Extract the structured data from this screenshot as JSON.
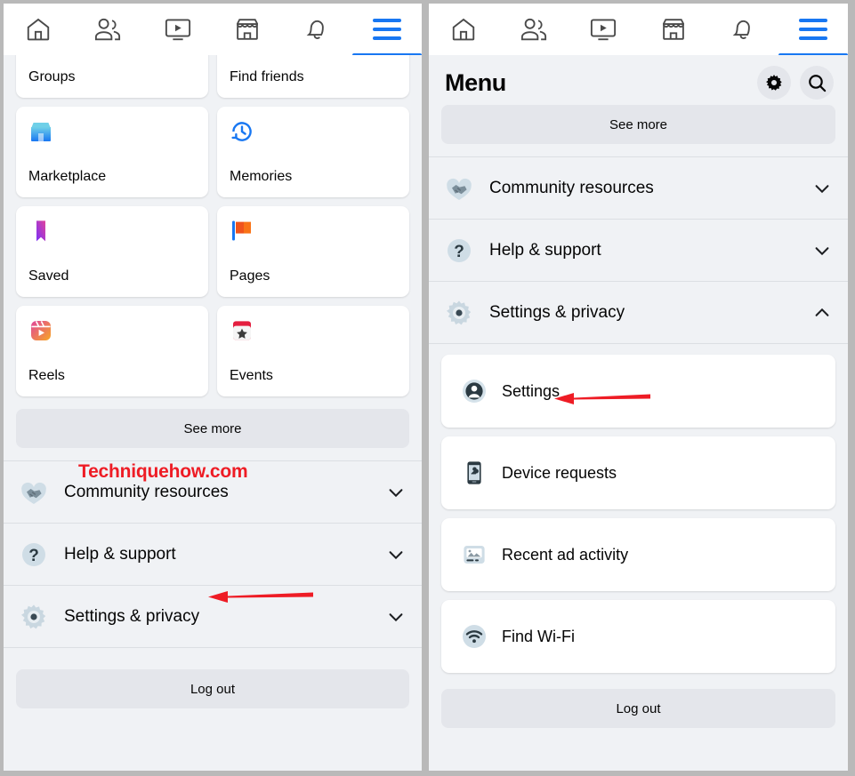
{
  "colors": {
    "accent": "#1877f2",
    "page_bg": "#f0f2f5",
    "card_bg": "#ffffff",
    "pill_bg": "#e4e6eb",
    "annotation_red": "#ee1c25",
    "text_primary": "#050505"
  },
  "topnav": {
    "tabs": [
      {
        "name": "home-tab",
        "icon": "home-icon",
        "active": false
      },
      {
        "name": "friends-tab",
        "icon": "friends-icon",
        "active": false
      },
      {
        "name": "video-tab",
        "icon": "video-icon",
        "active": false
      },
      {
        "name": "marketplace-tab",
        "icon": "marketplace-icon",
        "active": false
      },
      {
        "name": "notifications-tab",
        "icon": "bell-icon",
        "active": false
      },
      {
        "name": "menu-tab",
        "icon": "hamburger-icon",
        "active": true
      }
    ]
  },
  "left_panel": {
    "grid": [
      {
        "label": "Groups",
        "icon": "groups-icon"
      },
      {
        "label": "Find friends",
        "icon": "find-friends-icon"
      },
      {
        "label": "Marketplace",
        "icon": "marketplace-storefront-icon"
      },
      {
        "label": "Memories",
        "icon": "memories-clock-icon"
      },
      {
        "label": "Saved",
        "icon": "saved-bookmark-icon"
      },
      {
        "label": "Pages",
        "icon": "pages-flag-icon"
      },
      {
        "label": "Reels",
        "icon": "reels-icon"
      },
      {
        "label": "Events",
        "icon": "events-calendar-icon"
      }
    ],
    "see_more": "See more",
    "rows": [
      {
        "label": "Community resources",
        "icon": "handshake-heart-icon",
        "chevron": "chevron-down-icon"
      },
      {
        "label": "Help & support",
        "icon": "question-mark-icon",
        "chevron": "chevron-down-icon"
      },
      {
        "label": "Settings & privacy",
        "icon": "gear-icon",
        "chevron": "chevron-down-icon"
      }
    ],
    "log_out": "Log out",
    "watermark": "Techniquehow.com"
  },
  "right_panel": {
    "header": {
      "title": "Menu",
      "settings_icon": "gear-icon",
      "search_icon": "search-icon"
    },
    "see_more": "See more",
    "rows": [
      {
        "label": "Community resources",
        "icon": "handshake-heart-icon",
        "chevron": "chevron-down-icon",
        "expanded": false
      },
      {
        "label": "Help & support",
        "icon": "question-mark-icon",
        "chevron": "chevron-down-icon",
        "expanded": false
      },
      {
        "label": "Settings & privacy",
        "icon": "gear-icon",
        "chevron": "chevron-up-icon",
        "expanded": true
      }
    ],
    "sub_items": [
      {
        "label": "Settings",
        "icon": "account-avatar-icon"
      },
      {
        "label": "Device requests",
        "icon": "device-phone-icon"
      },
      {
        "label": "Recent ad activity",
        "icon": "ad-image-icon"
      },
      {
        "label": "Find Wi-Fi",
        "icon": "wifi-icon"
      }
    ],
    "log_out": "Log out"
  }
}
